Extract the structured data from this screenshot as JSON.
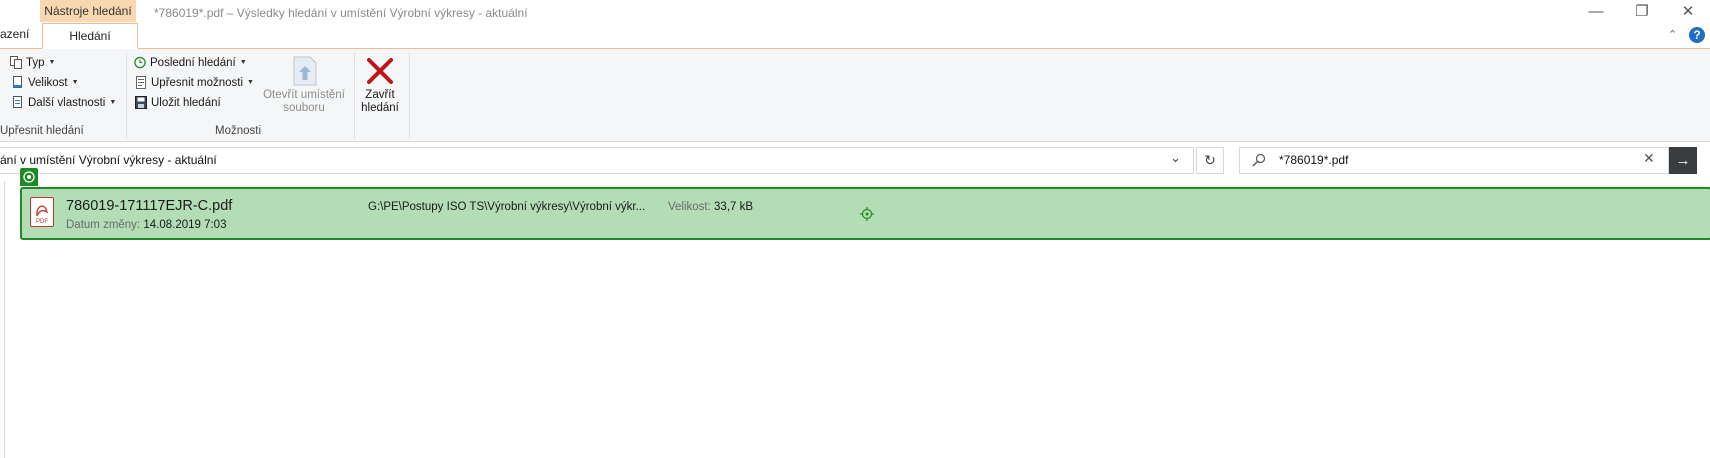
{
  "title_bar": {
    "context_tab": "Nástroje hledání",
    "window_title": "*786019*.pdf – Výsledky hledání v umístění Výrobní výkresy - aktuální",
    "minimize_icon": "minimize-icon",
    "restore_icon": "restore-icon",
    "close_icon": "close-icon"
  },
  "tabs": {
    "left_partial": "azení",
    "active": "Hledání",
    "collapse_icon": "chevron-up-icon",
    "help": "?"
  },
  "ribbon": {
    "refine": {
      "type": "Typ",
      "size": "Velikost",
      "other_props": "Další vlastnosti",
      "group_label": "Upřesnit hledání"
    },
    "options": {
      "recent": "Poslední hledání",
      "advanced": "Upřesnit možnosti",
      "save": "Uložit hledání",
      "open_location_line1": "Otevřít umístění",
      "open_location_line2": "souboru",
      "group_label": "Možnosti"
    },
    "close": {
      "line1": "Zavřít",
      "line2": "hledání"
    }
  },
  "address_bar": {
    "text": "ání v umístění Výrobní výkresy - aktuální",
    "dropdown_icon": "chevron-down-icon",
    "refresh_icon": "refresh-icon"
  },
  "search": {
    "value": "*786019*.pdf",
    "search_icon": "search-icon",
    "clear_icon": "clear-icon",
    "go_icon": "arrow-right-icon"
  },
  "results": [
    {
      "name": "786019-171117EJR-C.pdf",
      "date_label": "Datum změny:",
      "date_value": "14.08.2019 7:03",
      "path": "G:\\PE\\Postupy ISO TS\\Výrobní výkresy\\Výrobní výkr...",
      "size_label": "Velikost:",
      "size_value": "33,7 kB",
      "file_icon": "pdf-file-icon"
    }
  ],
  "colors": {
    "accent_orange": "#f9d7b0",
    "selection_green": "#b3ddb5",
    "selection_border": "#1f8a24",
    "close_red": "#c0151b"
  }
}
